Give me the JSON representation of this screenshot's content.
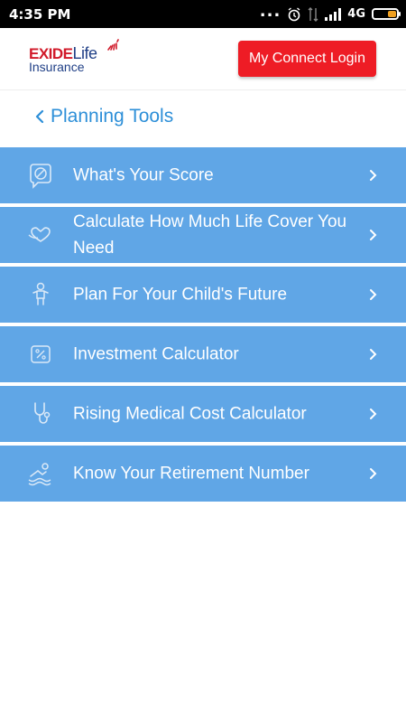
{
  "status_bar": {
    "time": "4:35 PM",
    "dots": "...",
    "network": "4G"
  },
  "header": {
    "logo_brand": "EXIDE",
    "logo_brand_life": "Life",
    "logo_sub": "Insurance",
    "login_label": "My Connect Login",
    "brand_red": "#ee1c25",
    "brand_blue": "#1f3f86"
  },
  "page": {
    "title": "Planning Tools",
    "accent": "#2d8fd8"
  },
  "menu": {
    "item_color": "#60a6e6",
    "items": [
      {
        "label": "What's Your Score",
        "icon": "score-icon"
      },
      {
        "label": "Calculate How Much Life Cover You Need",
        "icon": "heart-hand-icon"
      },
      {
        "label": "Plan For Your Child's Future",
        "icon": "child-icon"
      },
      {
        "label": "Investment Calculator",
        "icon": "percent-icon"
      },
      {
        "label": "Rising Medical Cost Calculator",
        "icon": "stethoscope-icon"
      },
      {
        "label": "Know Your Retirement Number",
        "icon": "beach-icon"
      }
    ]
  }
}
